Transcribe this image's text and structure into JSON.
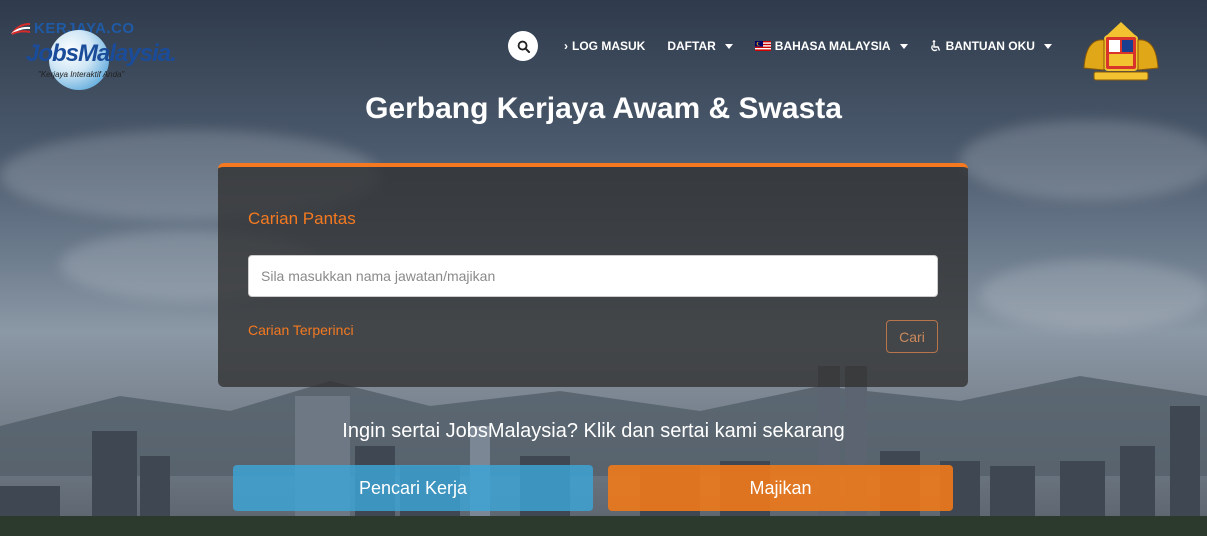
{
  "logo": {
    "brand_top": "KERJAYA.CO",
    "brand_main": "JobsMalaysia.",
    "tagline": "\"Kerjaya Interaktif Anda\""
  },
  "nav": {
    "search_icon": "search-icon",
    "items": [
      {
        "label": "LOG MASUK",
        "icon": "chevron-right-icon"
      },
      {
        "label": "DAFTAR",
        "dropdown": true
      },
      {
        "label": "BAHASA MALAYSIA",
        "icon": "flag-malaysia-icon",
        "dropdown": true
      },
      {
        "label": "BANTUAN OKU",
        "icon": "wheelchair-icon",
        "dropdown": true
      }
    ]
  },
  "hero": {
    "title_light": "Gerbang Kerjaya ",
    "title_bold": "Awam & Swasta"
  },
  "search": {
    "panel_title": "Carian Pantas",
    "placeholder": "Sila masukkan nama jawatan/majikan",
    "value": "",
    "advanced_link": "Carian Terperinci",
    "submit_label": "Cari"
  },
  "join": {
    "prompt": "Ingin sertai JobsMalaysia? Klik dan sertai kami sekarang",
    "jobseeker_label": "Pencari Kerja",
    "employer_label": "Majikan"
  },
  "colors": {
    "accent": "#f47920",
    "jobseeker": "#3ca5d7",
    "employer": "#ec781c"
  }
}
